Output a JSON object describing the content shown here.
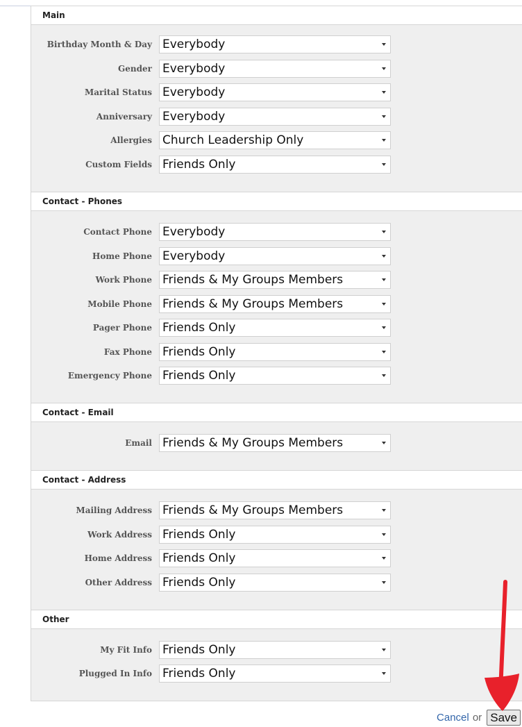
{
  "sections": [
    {
      "title": "Main",
      "rows": [
        {
          "label": "Birthday Month & Day",
          "value": "Everybody"
        },
        {
          "label": "Gender",
          "value": "Everybody"
        },
        {
          "label": "Marital Status",
          "value": "Everybody"
        },
        {
          "label": "Anniversary",
          "value": "Everybody"
        },
        {
          "label": "Allergies",
          "value": "Church Leadership Only"
        },
        {
          "label": "Custom Fields",
          "value": "Friends Only"
        }
      ]
    },
    {
      "title": "Contact - Phones",
      "rows": [
        {
          "label": "Contact Phone",
          "value": "Everybody"
        },
        {
          "label": "Home Phone",
          "value": "Everybody"
        },
        {
          "label": "Work Phone",
          "value": "Friends & My Groups Members"
        },
        {
          "label": "Mobile Phone",
          "value": "Friends & My Groups Members"
        },
        {
          "label": "Pager Phone",
          "value": "Friends Only"
        },
        {
          "label": "Fax Phone",
          "value": "Friends Only"
        },
        {
          "label": "Emergency Phone",
          "value": "Friends Only"
        }
      ]
    },
    {
      "title": "Contact - Email",
      "rows": [
        {
          "label": "Email",
          "value": "Friends & My Groups Members"
        }
      ]
    },
    {
      "title": "Contact - Address",
      "rows": [
        {
          "label": "Mailing Address",
          "value": "Friends & My Groups Members"
        },
        {
          "label": "Work Address",
          "value": "Friends Only"
        },
        {
          "label": "Home Address",
          "value": "Friends Only"
        },
        {
          "label": "Other Address",
          "value": "Friends Only"
        }
      ]
    },
    {
      "title": "Other",
      "rows": [
        {
          "label": "My Fit Info",
          "value": "Friends Only"
        },
        {
          "label": "Plugged In Info",
          "value": "Friends Only"
        }
      ]
    }
  ],
  "footer": {
    "cancel_label": "Cancel",
    "or_label": "or",
    "save_label": "Save"
  },
  "annotation": {
    "type": "red-arrow",
    "color": "#e8212b"
  }
}
